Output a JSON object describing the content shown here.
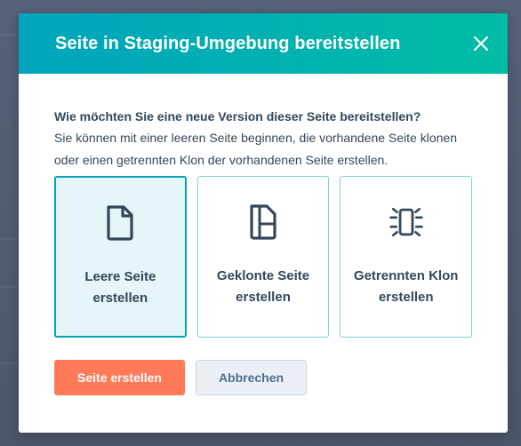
{
  "modal": {
    "title": "Seite in Staging-Umgebung bereitstellen",
    "close_icon": "close-icon",
    "question": "Wie möchten Sie eine neue Version dieser Seite bereitstellen?",
    "description": "Sie können mit einer leeren Seite beginnen, die vorhandene Seite klonen oder einen getrennten Klon der vorhandenen Seite erstellen.",
    "options": [
      {
        "label": "Leere Seite erstellen",
        "icon": "blank-page-icon",
        "selected": true
      },
      {
        "label": "Geklonte Seite erstellen",
        "icon": "cloned-page-icon",
        "selected": false
      },
      {
        "label": "Getrennten Klon erstellen",
        "icon": "detached-clone-icon",
        "selected": false
      }
    ],
    "buttons": {
      "primary": "Seite erstellen",
      "secondary": "Abbrechen"
    }
  },
  "colors": {
    "header_gradient_start": "#00a4bd",
    "header_gradient_end": "#00bda5",
    "primary_button": "#ff7a59",
    "selected_card_bg": "#e5f5f8",
    "text": "#33475b"
  }
}
